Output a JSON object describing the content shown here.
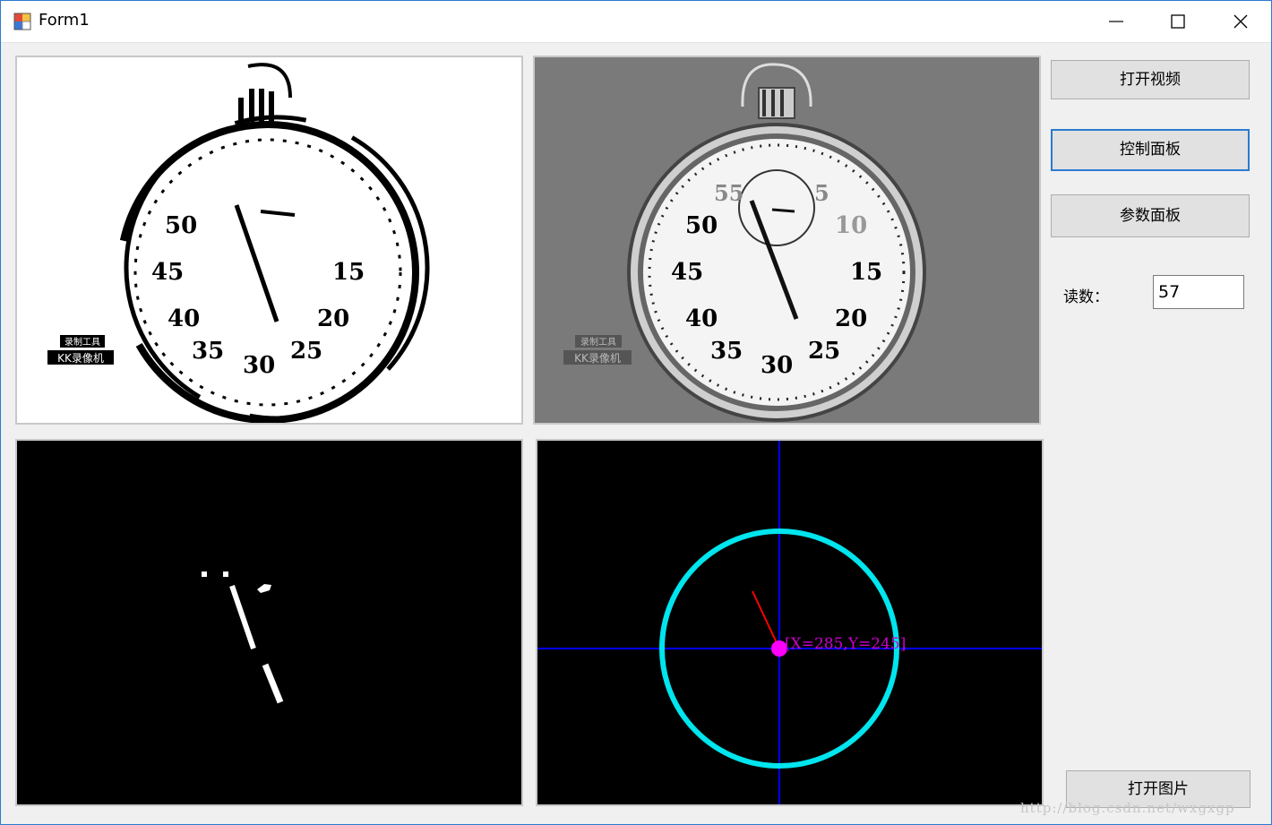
{
  "window": {
    "title": "Form1"
  },
  "buttons": {
    "open_video": "打开视频",
    "control_panel": "控制面板",
    "param_panel": "参数面板",
    "open_image": "打开图片"
  },
  "reading": {
    "label": "读数：",
    "value": "57"
  },
  "panel1": {
    "numbers": [
      "50",
      "45",
      "40",
      "35",
      "30",
      "25",
      "20",
      "15"
    ],
    "logo_top": "录制工具",
    "logo_bottom": "KK录像机"
  },
  "panel2": {
    "numbers": [
      "55",
      "5",
      "50",
      "10",
      "45",
      "15",
      "40",
      "20",
      "35",
      "30",
      "25"
    ],
    "logo_top": "录制工具",
    "logo_bottom": "KK录像机"
  },
  "panel4": {
    "center_label": "[X=285,Y=245]"
  },
  "watermark": "http://blog.csdn.net/wxgxgp",
  "colors": {
    "accent": "#2b7bd1",
    "circle": "#00e5ee",
    "crosshair": "#0000ff",
    "pointer": "#ff0000",
    "center": "#ff00ff"
  }
}
